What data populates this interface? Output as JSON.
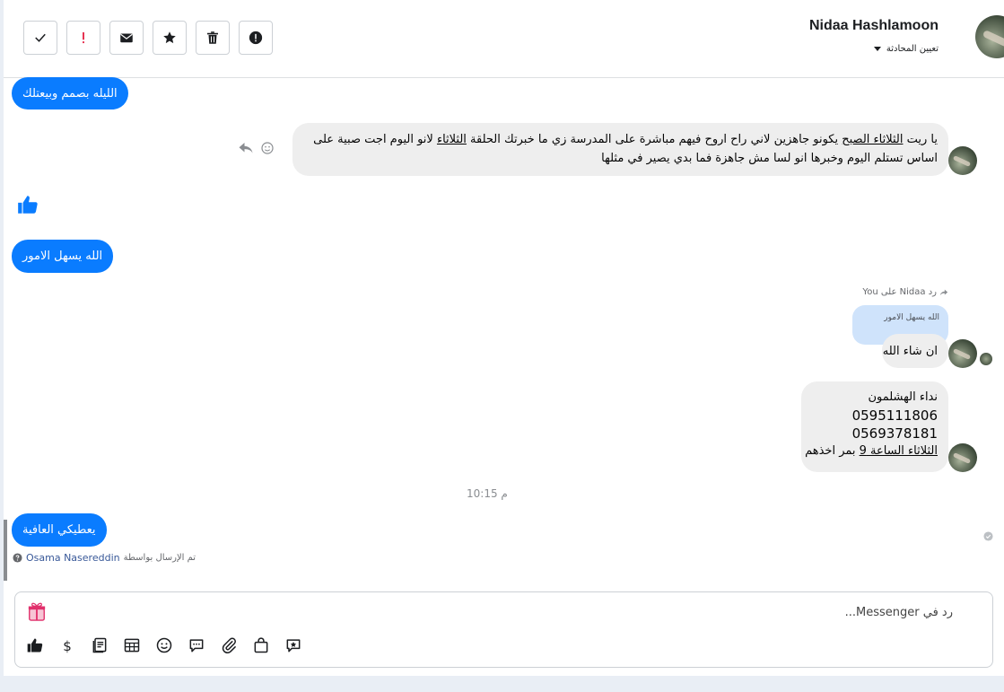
{
  "header": {
    "contact_name": "Nidaa Hashlamoon",
    "assign_label": "تعيين المحادثة"
  },
  "messages": {
    "out1": "الليله بصمم وبيعتلك",
    "in1_line1_pre": "يا ريت ",
    "in1_line1_u1": "الثلاثاء الصبح",
    "in1_line1_mid": " يكونو جاهزين لاني راح اروح فيهم مباشرة على المدرسة زي ما خبرتك الحلقة ",
    "in1_line1_u2": "الثلاثاء",
    "in1_line1_post": " لانو اليوم اجت صبية على",
    "in1_line2": "اساس تستلم اليوم وخبرها انو لسا مش جاهزة فما بدي يصير في مثلها",
    "out2": "الله يسهل الامور",
    "reply_header": "رد Nidaa على You",
    "reply_quote": "الله يسهل الامور",
    "in2": "ان شاء الله",
    "in3_name": "نداء الهشلمون",
    "in3_phone1": "0595111806",
    "in3_phone2": "0569378181",
    "in3_line4_u": "الثلاثاء الساعة 9",
    "in3_line4_post": " بمر اخذهم",
    "timestamp": "10:15 م",
    "out3": "يعطيكي العافية",
    "sent_by_prefix": "تم الإرسال بواسطة",
    "sent_by_name": "Osama Nasereddin"
  },
  "composer": {
    "placeholder": "رد في Messenger..."
  },
  "colors": {
    "accent": "#0a7cff",
    "incoming": "#eeeeee",
    "reply_quote_bg": "#cfe3fb"
  }
}
